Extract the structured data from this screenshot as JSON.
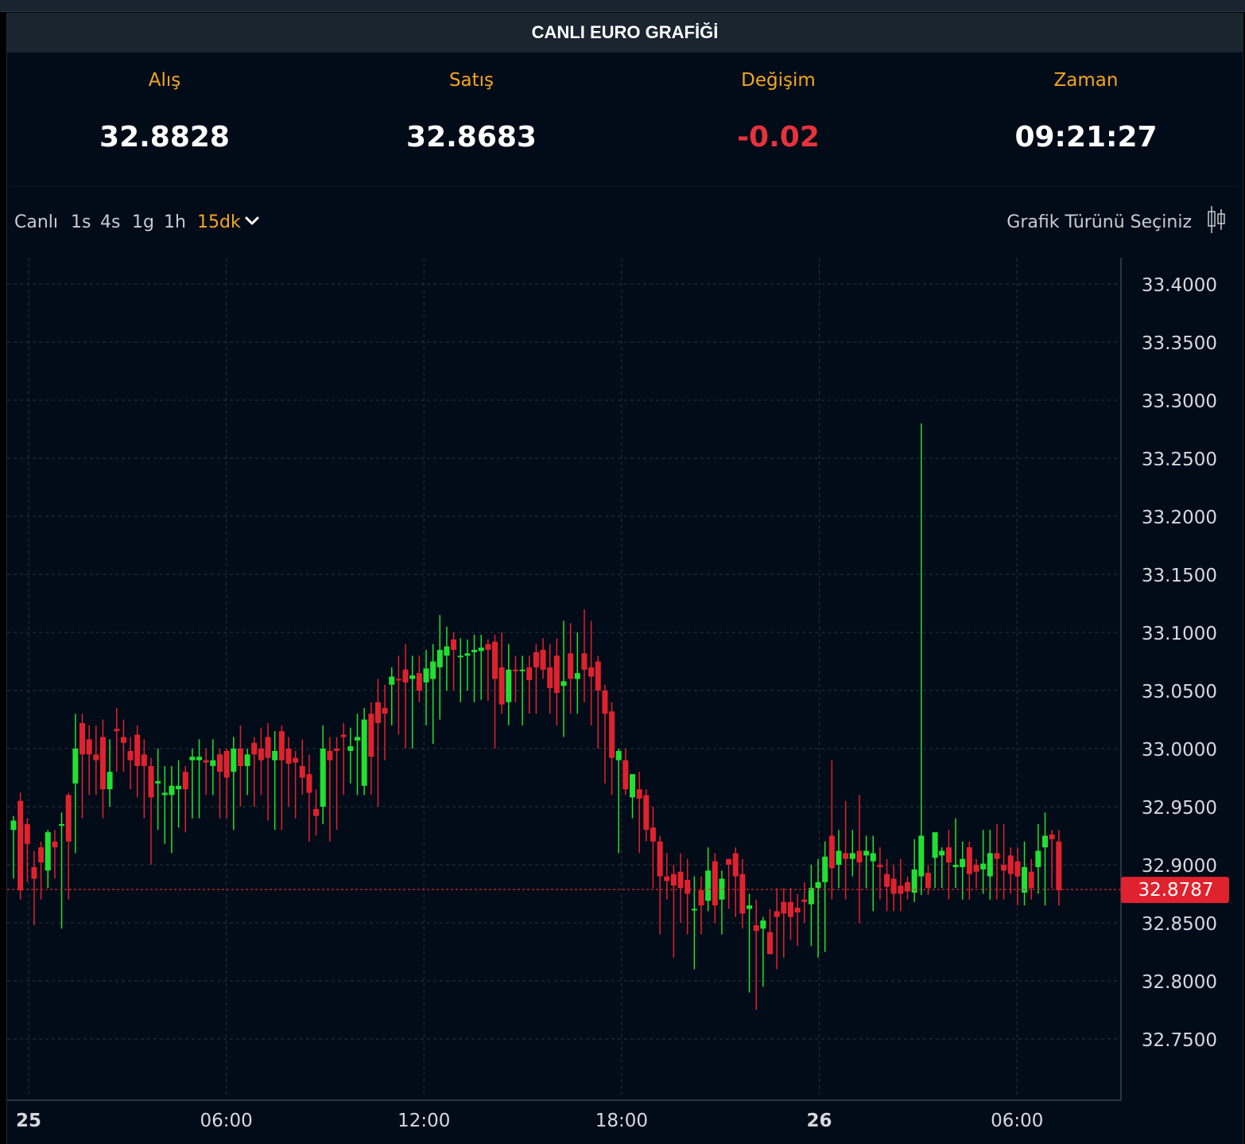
{
  "header": {
    "title": "CANLI EURO GRAFİĞİ"
  },
  "stats": {
    "buy": {
      "label": "Alış",
      "value": "32.8828"
    },
    "sell": {
      "label": "Satış",
      "value": "32.8683"
    },
    "change": {
      "label": "Değişim",
      "value": "-0.02",
      "color": "#e8323c"
    },
    "time": {
      "label": "Zaman",
      "value": "09:21:27"
    }
  },
  "toolbar": {
    "timeframes": [
      "Canlı",
      "1s",
      "4s",
      "1g",
      "1h",
      "15dk"
    ],
    "active_timeframe": "15dk",
    "chart_type_label": "Grafik Türünü Seçiniz",
    "icons": [
      "chevron-down-icon",
      "candlestick-icon"
    ]
  },
  "colors": {
    "up": "#22e032",
    "down": "#e0222e",
    "accent": "#f5a623",
    "background": "#020b18"
  },
  "chart_data": {
    "type": "candlestick",
    "interval": "15dk",
    "ylim": [
      32.73,
      33.42
    ],
    "y_ticks": [
      "33.4000",
      "33.3500",
      "33.3000",
      "33.2500",
      "33.2000",
      "33.1500",
      "33.1000",
      "33.0500",
      "33.0000",
      "32.9500",
      "32.9000",
      "32.8500",
      "32.8000",
      "32.7500"
    ],
    "x_ticks": [
      "25",
      "06:00",
      "12:00",
      "18:00",
      "26",
      "06:00"
    ],
    "x_tick_bold": [
      true,
      false,
      false,
      false,
      true,
      false
    ],
    "last_price": "32.8787",
    "grid": true,
    "candles": [
      [
        32.93,
        32.942,
        32.888,
        32.938
      ],
      [
        32.955,
        32.962,
        32.87,
        32.878
      ],
      [
        32.935,
        32.94,
        32.885,
        32.918
      ],
      [
        32.898,
        32.912,
        32.848,
        32.888
      ],
      [
        32.915,
        32.92,
        32.87,
        32.902
      ],
      [
        32.895,
        32.93,
        32.88,
        32.928
      ],
      [
        32.92,
        32.93,
        32.888,
        32.915
      ],
      [
        32.935,
        32.945,
        32.845,
        32.935
      ],
      [
        32.96,
        32.962,
        32.87,
        32.92
      ],
      [
        32.97,
        33.03,
        32.91,
        33.0
      ],
      [
        33.022,
        33.03,
        32.94,
        32.995
      ],
      [
        33.008,
        33.02,
        32.96,
        32.995
      ],
      [
        32.995,
        33.02,
        32.96,
        32.99
      ],
      [
        33.01,
        33.025,
        32.94,
        32.965
      ],
      [
        32.965,
        33.008,
        32.95,
        32.98
      ],
      [
        33.017,
        33.035,
        32.98,
        33.015
      ],
      [
        33.01,
        33.025,
        32.98,
        33.005
      ],
      [
        32.998,
        33.01,
        32.965,
        32.99
      ],
      [
        33.012,
        33.02,
        32.958,
        32.985
      ],
      [
        32.995,
        33.008,
        32.94,
        32.985
      ],
      [
        32.985,
        32.992,
        32.9,
        32.958
      ],
      [
        32.97,
        33.0,
        32.93,
        32.972
      ],
      [
        32.96,
        32.985,
        32.918,
        32.962
      ],
      [
        32.96,
        32.985,
        32.91,
        32.968
      ],
      [
        32.965,
        32.99,
        32.932,
        32.968
      ],
      [
        32.98,
        32.985,
        32.928,
        32.965
      ],
      [
        32.99,
        33.0,
        32.94,
        32.993
      ],
      [
        32.99,
        33.008,
        32.94,
        32.993
      ],
      [
        32.99,
        33.0,
        32.96,
        32.988
      ],
      [
        32.985,
        33.008,
        32.96,
        32.99
      ],
      [
        32.995,
        33.0,
        32.94,
        32.98
      ],
      [
        32.998,
        33.0,
        32.94,
        32.975
      ],
      [
        32.98,
        33.01,
        32.93,
        33.0
      ],
      [
        33.0,
        33.02,
        32.95,
        32.985
      ],
      [
        32.985,
        33.0,
        32.96,
        32.995
      ],
      [
        33.005,
        33.01,
        32.95,
        32.995
      ],
      [
        33.0,
        33.018,
        32.96,
        32.99
      ],
      [
        33.01,
        33.022,
        32.938,
        32.992
      ],
      [
        32.99,
        33.015,
        32.93,
        32.998
      ],
      [
        33.015,
        33.02,
        32.93,
        32.99
      ],
      [
        33.0,
        33.01,
        32.95,
        32.987
      ],
      [
        32.992,
        32.998,
        32.94,
        32.988
      ],
      [
        32.985,
        33.008,
        32.96,
        32.975
      ],
      [
        32.978,
        32.995,
        32.92,
        32.962
      ],
      [
        32.948,
        32.965,
        32.925,
        32.942
      ],
      [
        32.95,
        33.02,
        32.935,
        33.0
      ],
      [
        32.998,
        33.01,
        32.92,
        32.99
      ],
      [
        33.0,
        33.01,
        32.93,
        32.998
      ],
      [
        33.012,
        33.022,
        32.96,
        33.01
      ],
      [
        32.998,
        33.018,
        32.97,
        33.002
      ],
      [
        33.007,
        33.03,
        32.96,
        33.01
      ],
      [
        32.968,
        33.035,
        32.96,
        33.025
      ],
      [
        33.03,
        33.04,
        32.96,
        32.993
      ],
      [
        33.04,
        33.06,
        32.95,
        33.022
      ],
      [
        33.035,
        33.055,
        32.99,
        33.03
      ],
      [
        33.055,
        33.07,
        33.02,
        33.062
      ],
      [
        33.06,
        33.08,
        33.012,
        33.059
      ],
      [
        33.068,
        33.09,
        33.0,
        33.057
      ],
      [
        33.06,
        33.08,
        33.0,
        33.063
      ],
      [
        33.065,
        33.08,
        33.04,
        33.05
      ],
      [
        33.057,
        33.085,
        33.02,
        33.069
      ],
      [
        33.06,
        33.09,
        33.004,
        33.075
      ],
      [
        33.07,
        33.115,
        33.025,
        33.085
      ],
      [
        33.08,
        33.105,
        33.05,
        33.088
      ],
      [
        33.094,
        33.1,
        33.05,
        33.085
      ],
      [
        33.08,
        33.095,
        33.04,
        33.08
      ],
      [
        33.08,
        33.094,
        33.05,
        33.082
      ],
      [
        33.083,
        33.098,
        33.04,
        33.085
      ],
      [
        33.084,
        33.098,
        33.042,
        33.087
      ],
      [
        33.09,
        33.094,
        33.041,
        33.085
      ],
      [
        33.092,
        33.098,
        33.0,
        33.06
      ],
      [
        33.07,
        33.1,
        33.03,
        33.038
      ],
      [
        33.04,
        33.09,
        33.02,
        33.068
      ],
      [
        33.068,
        33.08,
        33.04,
        33.067
      ],
      [
        33.068,
        33.08,
        33.02,
        33.068
      ],
      [
        33.07,
        33.08,
        33.03,
        33.059
      ],
      [
        33.083,
        33.09,
        33.03,
        33.07
      ],
      [
        33.085,
        33.095,
        33.06,
        33.068
      ],
      [
        33.07,
        33.09,
        33.03,
        33.052
      ],
      [
        33.08,
        33.095,
        33.02,
        33.048
      ],
      [
        33.054,
        33.11,
        33.01,
        33.058
      ],
      [
        33.082,
        33.108,
        33.03,
        33.06
      ],
      [
        33.06,
        33.1,
        33.03,
        33.065
      ],
      [
        33.082,
        33.12,
        33.04,
        33.068
      ],
      [
        33.07,
        33.11,
        33.02,
        33.062
      ],
      [
        33.075,
        33.08,
        33.0,
        33.05
      ],
      [
        33.05,
        33.055,
        32.97,
        33.03
      ],
      [
        33.032,
        33.04,
        32.96,
        32.992
      ],
      [
        32.99,
        33.0,
        32.91,
        32.998
      ],
      [
        32.99,
        33.0,
        32.96,
        32.965
      ],
      [
        32.958,
        32.965,
        32.94,
        32.978
      ],
      [
        32.965,
        32.98,
        32.91,
        32.957
      ],
      [
        32.96,
        32.965,
        32.92,
        32.93
      ],
      [
        32.932,
        32.95,
        32.88,
        32.92
      ],
      [
        32.92,
        32.925,
        32.84,
        32.89
      ],
      [
        32.89,
        32.91,
        32.87,
        32.886
      ],
      [
        32.892,
        32.9,
        32.82,
        32.882
      ],
      [
        32.894,
        32.91,
        32.85,
        32.88
      ],
      [
        32.887,
        32.905,
        32.84,
        32.875
      ],
      [
        32.862,
        32.89,
        32.81,
        32.862
      ],
      [
        32.878,
        32.89,
        32.84,
        32.865
      ],
      [
        32.869,
        32.915,
        32.86,
        32.895
      ],
      [
        32.903,
        32.91,
        32.85,
        32.865
      ],
      [
        32.87,
        32.895,
        32.84,
        32.888
      ],
      [
        32.905,
        32.905,
        32.862,
        32.9
      ],
      [
        32.91,
        32.915,
        32.855,
        32.89
      ],
      [
        32.892,
        32.905,
        32.845,
        32.858
      ],
      [
        32.862,
        32.875,
        32.79,
        32.865
      ],
      [
        32.848,
        32.87,
        32.775,
        32.843
      ],
      [
        32.845,
        32.855,
        32.795,
        32.852
      ],
      [
        32.842,
        32.862,
        32.83,
        32.823
      ],
      [
        32.86,
        32.88,
        32.81,
        32.855
      ],
      [
        32.868,
        32.88,
        32.82,
        32.858
      ],
      [
        32.868,
        32.88,
        32.835,
        32.855
      ],
      [
        32.863,
        32.875,
        32.83,
        32.859
      ],
      [
        32.87,
        32.885,
        32.85,
        32.868
      ],
      [
        32.866,
        32.9,
        32.83,
        32.88
      ],
      [
        32.88,
        32.905,
        32.82,
        32.885
      ],
      [
        32.885,
        32.92,
        32.825,
        32.907
      ],
      [
        32.925,
        32.99,
        32.87,
        32.897
      ],
      [
        32.9,
        32.93,
        32.88,
        32.912
      ],
      [
        32.91,
        32.955,
        32.87,
        32.905
      ],
      [
        32.905,
        32.93,
        32.89,
        32.91
      ],
      [
        32.912,
        32.96,
        32.85,
        32.902
      ],
      [
        32.908,
        32.925,
        32.88,
        32.912
      ],
      [
        32.903,
        32.925,
        32.86,
        32.91
      ],
      [
        32.9,
        32.915,
        32.87,
        32.898
      ],
      [
        32.892,
        32.905,
        32.86,
        32.881
      ],
      [
        32.888,
        32.9,
        32.86,
        32.875
      ],
      [
        32.882,
        32.905,
        32.86,
        32.875
      ],
      [
        32.885,
        32.89,
        32.87,
        32.877
      ],
      [
        32.876,
        32.922,
        32.868,
        32.896
      ],
      [
        32.89,
        33.28,
        32.874,
        32.925
      ],
      [
        32.893,
        32.9,
        32.874,
        32.88
      ],
      [
        32.906,
        32.92,
        32.88,
        32.928
      ],
      [
        32.908,
        32.915,
        32.88,
        32.912
      ],
      [
        32.915,
        32.93,
        32.87,
        32.902
      ],
      [
        32.898,
        32.94,
        32.88,
        32.9
      ],
      [
        32.898,
        32.92,
        32.87,
        32.905
      ],
      [
        32.915,
        32.92,
        32.87,
        32.892
      ],
      [
        32.9,
        32.905,
        32.88,
        32.894
      ],
      [
        32.896,
        32.93,
        32.875,
        32.901
      ],
      [
        32.89,
        32.93,
        32.87,
        32.91
      ],
      [
        32.91,
        32.935,
        32.87,
        32.905
      ],
      [
        32.9,
        32.935,
        32.87,
        32.895
      ],
      [
        32.908,
        32.915,
        32.875,
        32.892
      ],
      [
        32.903,
        32.915,
        32.865,
        32.89
      ],
      [
        32.876,
        32.92,
        32.865,
        32.898
      ],
      [
        32.894,
        32.905,
        32.87,
        32.88
      ],
      [
        32.898,
        32.935,
        32.875,
        32.912
      ],
      [
        32.915,
        32.945,
        32.865,
        32.925
      ],
      [
        32.926,
        32.93,
        32.88,
        32.922
      ],
      [
        32.92,
        32.93,
        32.865,
        32.878
      ]
    ]
  }
}
